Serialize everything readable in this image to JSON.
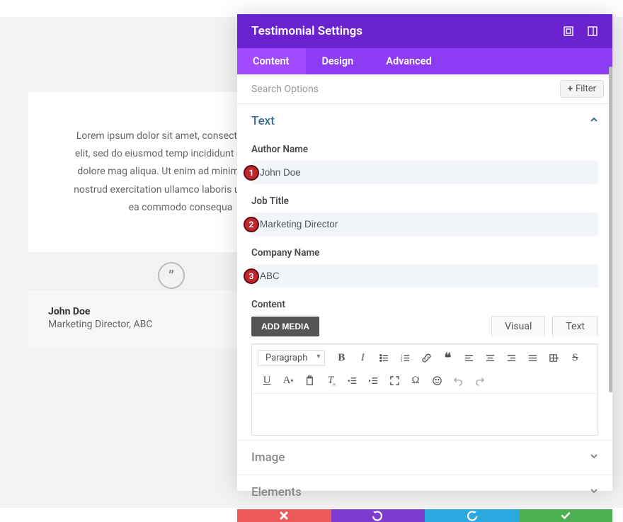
{
  "canvas": {
    "testimonial": {
      "body": "Lorem ipsum dolor sit amet, consect adipiscing elit, sed do eiusmod temp incididunt ut labore et dolore mag aliqua. Ut enim ad minim veniam, q nostrud exercitation ullamco laboris ut aliquip ex ea commodo consequa",
      "author_name": "John Doe",
      "author_role": "Marketing Director, ABC"
    }
  },
  "panel": {
    "title": "Testimonial Settings",
    "tabs": {
      "content": "Content",
      "design": "Design",
      "advanced": "Advanced"
    },
    "search_placeholder": "Search Options",
    "filter_label": "Filter",
    "sections": {
      "text": {
        "title": "Text",
        "author_name_label": "Author Name",
        "author_name_value": "John Doe",
        "job_title_label": "Job Title",
        "job_title_value": "Marketing Director",
        "company_label": "Company Name",
        "company_value": "ABC",
        "content_label": "Content",
        "add_media": "ADD MEDIA",
        "editor_tabs": {
          "visual": "Visual",
          "text": "Text"
        },
        "paragraph_selector": "Paragraph"
      },
      "image": {
        "title": "Image"
      },
      "elements": {
        "title": "Elements"
      }
    }
  },
  "annotations": {
    "b1": "1",
    "b2": "2",
    "b3": "3"
  }
}
